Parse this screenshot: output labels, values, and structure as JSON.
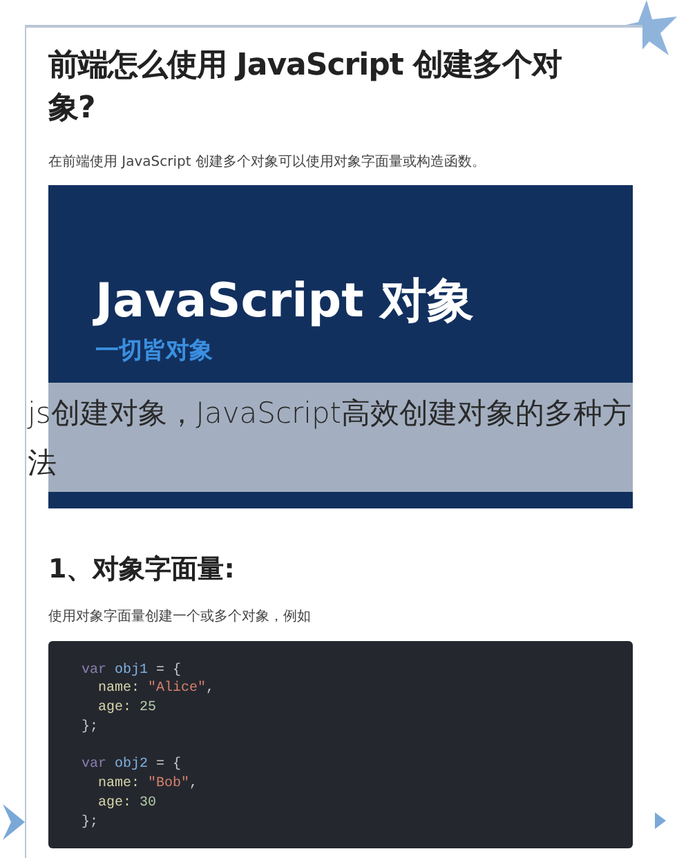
{
  "article": {
    "title": "前端怎么使用 JavaScript 创建多个对象?",
    "intro": "在前端使用 JavaScript 创建多个对象可以使用对象字面量或构造函数。",
    "banner": {
      "title": "JavaScript 对象",
      "subtitle": "一切皆对象"
    },
    "section_heading": "1、对象字面量:",
    "section_text": "使用对象字面量创建一个或多个对象，例如",
    "code": [
      [
        [
          {
            "text": "var ",
            "kind": "keyword"
          },
          {
            "text": "obj1",
            "kind": "name"
          },
          {
            "text": " = {",
            "kind": "plain"
          }
        ],
        [
          {
            "text": "  name: ",
            "kind": "prop"
          },
          {
            "text": "\"Alice\"",
            "kind": "string"
          },
          {
            "text": ",",
            "kind": "plain"
          }
        ],
        [
          {
            "text": "  age: ",
            "kind": "prop"
          },
          {
            "text": "25",
            "kind": "number"
          }
        ],
        [
          {
            "text": "};",
            "kind": "plain"
          }
        ]
      ],
      [
        [
          {
            "text": "var ",
            "kind": "keyword"
          },
          {
            "text": "obj2",
            "kind": "name"
          },
          {
            "text": " = {",
            "kind": "plain"
          }
        ],
        [
          {
            "text": "  name: ",
            "kind": "prop"
          },
          {
            "text": "\"Bob\"",
            "kind": "string"
          },
          {
            "text": ",",
            "kind": "plain"
          }
        ],
        [
          {
            "text": "  age: ",
            "kind": "prop"
          },
          {
            "text": "30",
            "kind": "number"
          }
        ],
        [
          {
            "text": "};",
            "kind": "plain"
          }
        ]
      ]
    ]
  },
  "caption": "js创建对象，JavaScript高效创建对象的多种方法"
}
